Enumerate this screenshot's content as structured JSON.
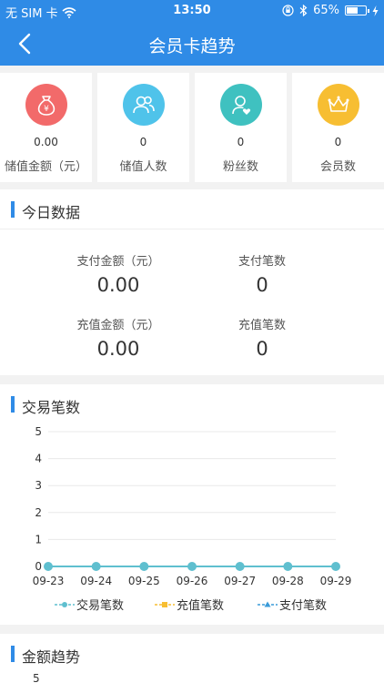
{
  "status_bar": {
    "carrier": "无 SIM 卡",
    "time": "13:50",
    "battery": "65%",
    "battery_level": 0.65
  },
  "nav": {
    "title": "会员卡趋势"
  },
  "summary": [
    {
      "value": "0.00",
      "label": "储值金额（元）",
      "icon": "money-bag-icon",
      "color": "#f26a6a"
    },
    {
      "value": "0",
      "label": "储值人数",
      "icon": "users-icon",
      "color": "#4fc3ea"
    },
    {
      "value": "0",
      "label": "粉丝数",
      "icon": "fan-heart-icon",
      "color": "#3fc1c0"
    },
    {
      "value": "0",
      "label": "会员数",
      "icon": "crown-icon",
      "color": "#f7be32"
    }
  ],
  "today": {
    "title": "今日数据",
    "pay_amount_label": "支付金额（元）",
    "pay_amount": "0.00",
    "pay_count_label": "支付笔数",
    "pay_count": "0",
    "recharge_amount_label": "充值金额（元）",
    "recharge_amount": "0.00",
    "recharge_count_label": "充值笔数",
    "recharge_count": "0"
  },
  "chart_data": {
    "type": "line",
    "title": "交易笔数",
    "categories": [
      "09-23",
      "09-24",
      "09-25",
      "09-26",
      "09-27",
      "09-28",
      "09-29"
    ],
    "series": [
      {
        "name": "交易笔数",
        "values": [
          0,
          0,
          0,
          0,
          0,
          0,
          0
        ],
        "color": "#5fbfcf",
        "marker": "circle"
      },
      {
        "name": "充值笔数",
        "values": [
          0,
          0,
          0,
          0,
          0,
          0,
          0
        ],
        "color": "#f7be32",
        "marker": "square"
      },
      {
        "name": "支付笔数",
        "values": [
          0,
          0,
          0,
          0,
          0,
          0,
          0
        ],
        "color": "#3a9bd9",
        "marker": "triangle"
      }
    ],
    "ylim": [
      0,
      5
    ],
    "yticks": [
      "0",
      "1",
      "2",
      "3",
      "4",
      "5"
    ],
    "grid": true,
    "legend": "bottom"
  },
  "amount_trend": {
    "title": "金额趋势",
    "first_tick": "5"
  },
  "colors": {
    "brand": "#2f8be6"
  }
}
